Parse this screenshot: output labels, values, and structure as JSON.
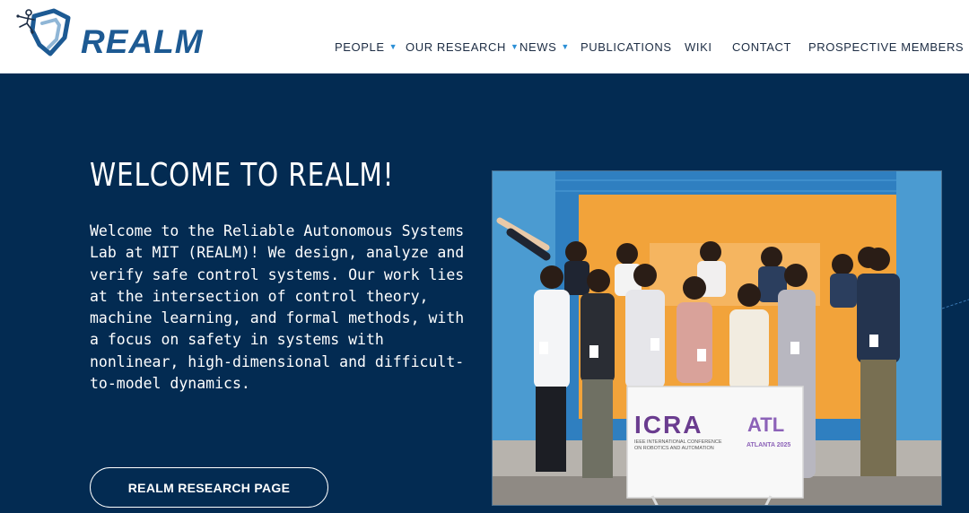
{
  "brand": {
    "name": "REALM",
    "primary": "#1d5a93",
    "hero_bg": "#032b52",
    "caret_color": "#2b8fd6"
  },
  "nav": {
    "items": [
      {
        "label": "PEOPLE",
        "has_dropdown": true
      },
      {
        "label": "OUR RESEARCH",
        "has_dropdown": true
      },
      {
        "label": "NEWS",
        "has_dropdown": true
      },
      {
        "label": "PUBLICATIONS",
        "has_dropdown": false
      },
      {
        "label": "WIKI",
        "has_dropdown": false
      },
      {
        "label": "CONTACT",
        "has_dropdown": false
      },
      {
        "label": "PROSPECTIVE MEMBERS",
        "has_dropdown": false
      }
    ],
    "dropdown_icon": "caret-down-icon"
  },
  "hero": {
    "title": "WELCOME TO REALM!",
    "body": "Welcome to the Reliable Autonomous Systems Lab at MIT (REALM)! We design, analyze and verify safe control systems. Our work lies at the intersection of control theory, machine learning, and formal methods, with a focus on safety in systems with nonlinear, high-dimensional and difficult-to-model dynamics.",
    "cta_label": "REALM RESEARCH PAGE"
  },
  "photo": {
    "sign_logo": "ICRA",
    "sign_subtitle_1": "IEEE INTERNATIONAL CONFERENCE",
    "sign_subtitle_2": "ON ROBOTICS AND AUTOMATION",
    "sign_city_logo": "ATL",
    "sign_city": "ATLANTA 2025"
  }
}
